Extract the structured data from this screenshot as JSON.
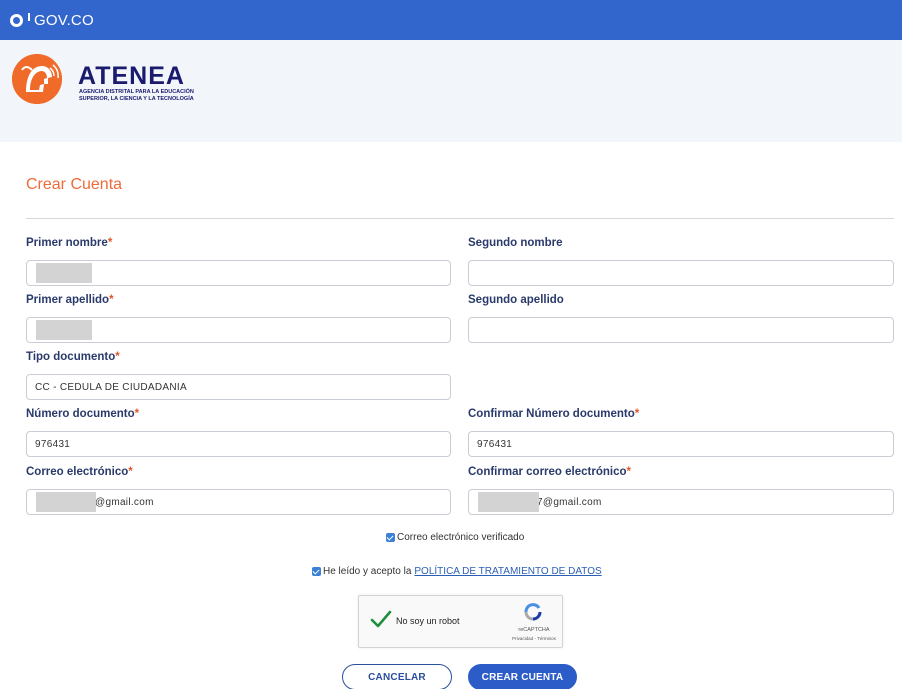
{
  "gov_bar": {
    "logo_text": "GOV.CO",
    "color": "#3366cc"
  },
  "brand": {
    "name": "ATENEA",
    "subtitle_line1": "AGENCIA DISTRITAL PARA LA EDUCACIÓN",
    "subtitle_line2": "SUPERIOR, LA CIENCIA Y LA TECNOLOGÍA",
    "accent": "#f06a2a"
  },
  "page": {
    "title": "Crear Cuenta",
    "title_color": "#ee6b3b"
  },
  "form": {
    "required_mark": "*",
    "fields": {
      "primer_nombre": {
        "label": "Primer nombre",
        "value": "",
        "redacted": true
      },
      "segundo_nombre": {
        "label": "Segundo nombre",
        "value": ""
      },
      "primer_apellido": {
        "label": "Primer apellido",
        "value": "",
        "redacted": true
      },
      "segundo_apellido": {
        "label": "Segundo apellido",
        "value": ""
      },
      "tipo_documento": {
        "label": "Tipo documento",
        "value": "CC - CEDULA DE CIUDADANIA"
      },
      "numero_documento": {
        "label": "Número documento",
        "value": "976431"
      },
      "confirmar_numero": {
        "label": "Confirmar Número documento",
        "value": "976431"
      },
      "correo": {
        "label": "Correo electrónico",
        "value": "@gmail.com",
        "redacted": true
      },
      "confirmar_correo": {
        "label": "Confirmar correo electrónico",
        "value": "7@gmail.com",
        "redacted": true
      }
    },
    "verified_label": "Correo electrónico verificado",
    "policy_prefix": "He leído y acepto la",
    "policy_link": "POLÍTICA DE TRATAMIENTO DE DATOS"
  },
  "captcha": {
    "label": "No soy un robot",
    "brand": "reCAPTCHA",
    "links": "Privacidad - Términos"
  },
  "buttons": {
    "cancel": "CANCELAR",
    "create": "CREAR CUENTA"
  }
}
